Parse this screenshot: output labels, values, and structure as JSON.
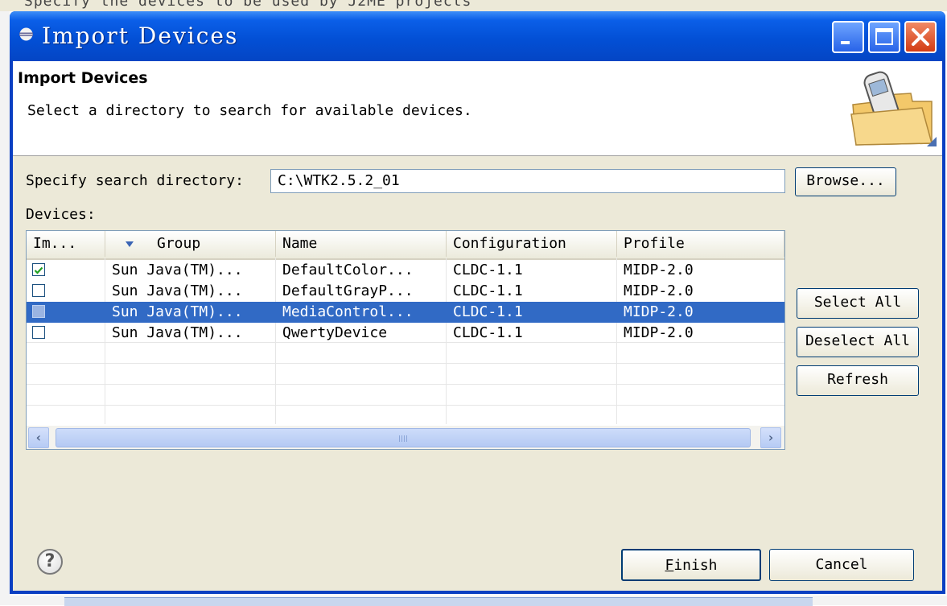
{
  "background": {
    "partial_text": "Specify the devices to be used by J2ME projects"
  },
  "window": {
    "title": "Import Devices",
    "controls": {
      "minimize": "minimize-icon",
      "maximize": "maximize-icon",
      "close": "close-icon"
    }
  },
  "header": {
    "title": "Import Devices",
    "description": "Select a directory to search for available devices."
  },
  "search": {
    "label": "Specify search directory:",
    "value": "C:\\WTK2.5.2_01",
    "browse_label": "Browse..."
  },
  "devices": {
    "label": "Devices:",
    "columns": [
      "Im...",
      "Group",
      "Name",
      "Configuration",
      "Profile"
    ],
    "rows": [
      {
        "checked": true,
        "selected": false,
        "group": "Sun Java(TM)...",
        "name": "DefaultColor...",
        "configuration": "CLDC-1.1",
        "profile": "MIDP-2.0"
      },
      {
        "checked": false,
        "selected": false,
        "group": "Sun Java(TM)...",
        "name": "DefaultGrayP...",
        "configuration": "CLDC-1.1",
        "profile": "MIDP-2.0"
      },
      {
        "checked": false,
        "selected": true,
        "group": "Sun Java(TM)...",
        "name": "MediaControl...",
        "configuration": "CLDC-1.1",
        "profile": "MIDP-2.0"
      },
      {
        "checked": false,
        "selected": false,
        "group": "Sun Java(TM)...",
        "name": "QwertyDevice",
        "configuration": "CLDC-1.1",
        "profile": "MIDP-2.0"
      }
    ]
  },
  "actions": {
    "select_all": "Select All",
    "deselect_all": "Deselect All",
    "refresh": "Refresh"
  },
  "footer": {
    "help_icon": "?",
    "finish_first": "F",
    "finish_rest": "inish",
    "cancel": "Cancel"
  },
  "colors": {
    "title_bar": "#0a52d8",
    "selection": "#316ac5",
    "dialog_bg": "#ece9d8"
  }
}
